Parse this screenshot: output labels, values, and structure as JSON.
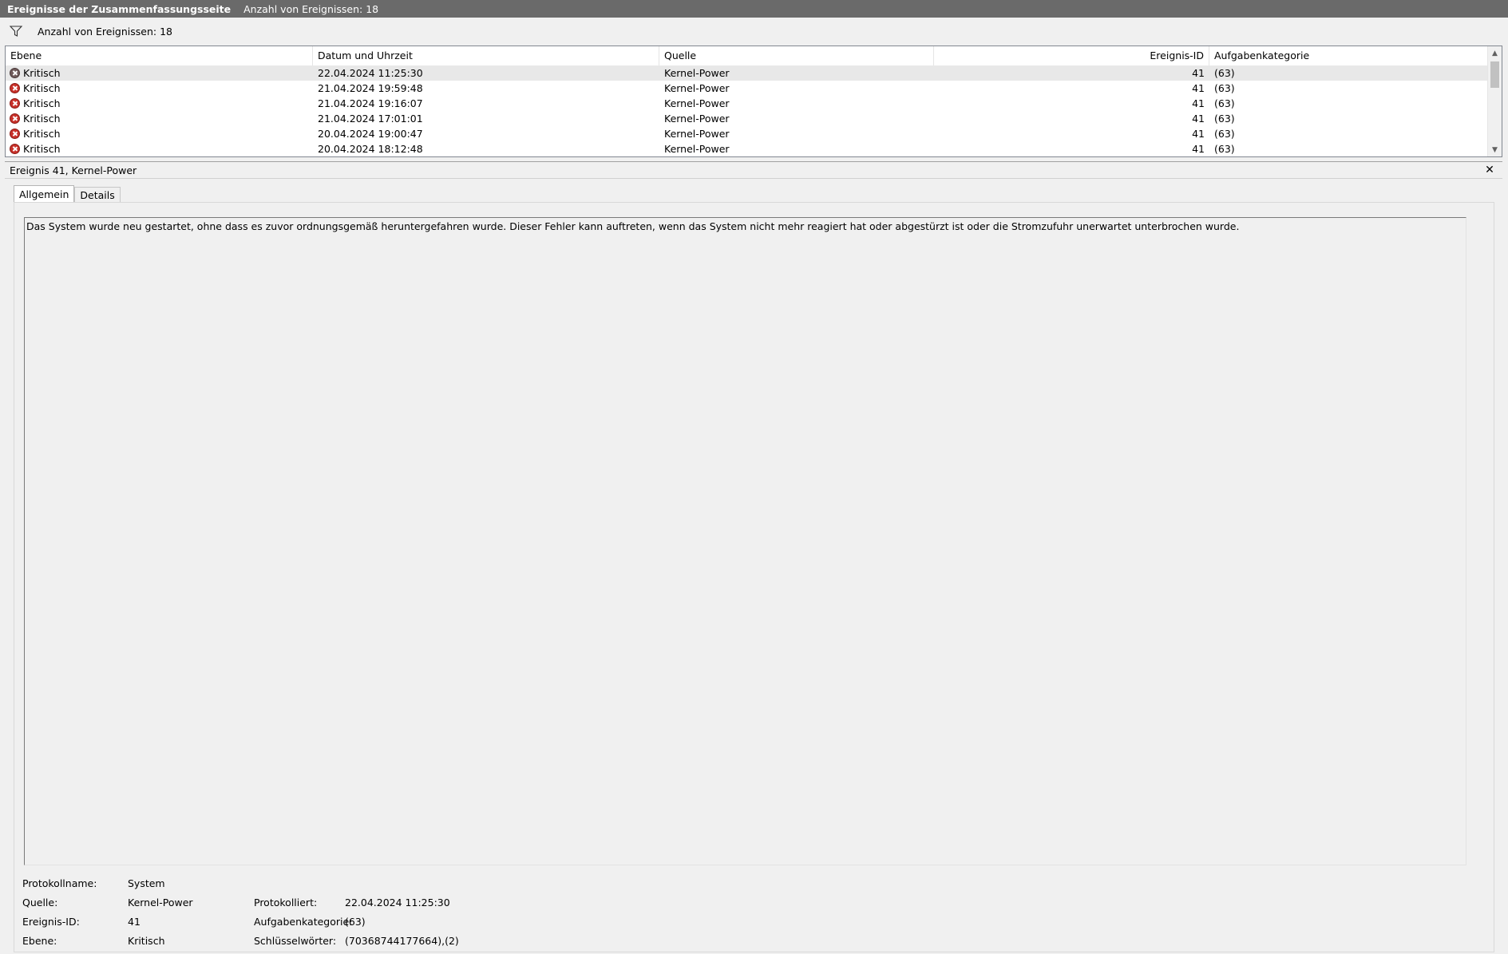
{
  "titlebar": {
    "title": "Ereignisse der Zusammenfassungsseite",
    "count": "Anzahl von Ereignissen: 18"
  },
  "filter": {
    "icon": "funnel-icon",
    "count": "Anzahl von Ereignissen: 18"
  },
  "grid": {
    "columns": [
      "Ebene",
      "Datum und Uhrzeit",
      "Quelle",
      "Ereignis-ID",
      "Aufgabenkategorie"
    ],
    "rows": [
      {
        "level": "Kritisch",
        "datetime": "22.04.2024 11:25:30",
        "source": "Kernel-Power",
        "id": "41",
        "category": "(63)"
      },
      {
        "level": "Kritisch",
        "datetime": "21.04.2024 19:59:48",
        "source": "Kernel-Power",
        "id": "41",
        "category": "(63)"
      },
      {
        "level": "Kritisch",
        "datetime": "21.04.2024 19:16:07",
        "source": "Kernel-Power",
        "id": "41",
        "category": "(63)"
      },
      {
        "level": "Kritisch",
        "datetime": "21.04.2024 17:01:01",
        "source": "Kernel-Power",
        "id": "41",
        "category": "(63)"
      },
      {
        "level": "Kritisch",
        "datetime": "20.04.2024 19:00:47",
        "source": "Kernel-Power",
        "id": "41",
        "category": "(63)"
      },
      {
        "level": "Kritisch",
        "datetime": "20.04.2024 18:12:48",
        "source": "Kernel-Power",
        "id": "41",
        "category": "(63)"
      }
    ]
  },
  "detail": {
    "header": "Ereignis 41, Kernel-Power",
    "tabs": [
      "Allgemein",
      "Details"
    ],
    "description": "Das System wurde neu gestartet, ohne dass es zuvor ordnungsgemäß heruntergefahren wurde. Dieser Fehler kann auftreten, wenn das System nicht mehr reagiert hat oder abgestürzt ist oder die Stromzufuhr unerwartet unterbrochen wurde.",
    "properties": {
      "log_name_label": "Protokollname:",
      "log_name": "System",
      "source_label": "Quelle:",
      "source": "Kernel-Power",
      "logged_label": "Protokolliert:",
      "logged": "22.04.2024 11:25:30",
      "event_id_label": "Ereignis-ID:",
      "event_id": "41",
      "task_category_label": "Aufgabenkategorie:",
      "task_category": "(63)",
      "level_label": "Ebene:",
      "level": "Kritisch",
      "keywords_label": "Schlüsselwörter:",
      "keywords": "(70368744177664),(2)"
    }
  }
}
